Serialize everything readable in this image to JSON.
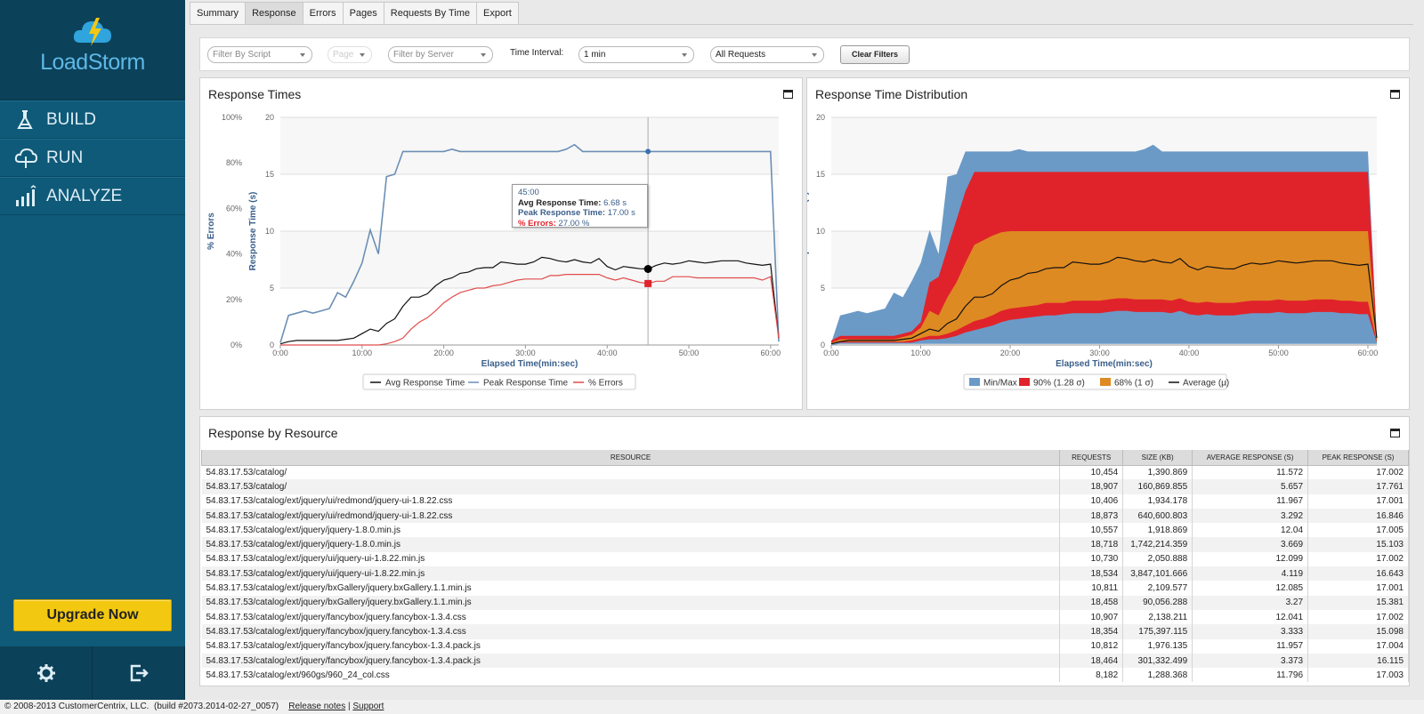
{
  "app": {
    "logo_text": "LoadStorm"
  },
  "sidebar": {
    "nav": [
      {
        "label": "BUILD",
        "icon": "flask-icon"
      },
      {
        "label": "RUN",
        "icon": "cloud-run-icon"
      },
      {
        "label": "ANALYZE",
        "icon": "bar-chart-icon"
      }
    ],
    "upgrade_label": "Upgrade Now",
    "bottom_icons": [
      "gear-icon",
      "logout-icon"
    ]
  },
  "tabs": [
    "Summary",
    "Response",
    "Errors",
    "Pages",
    "Requests By Time",
    "Export"
  ],
  "active_tab": "Response",
  "filters": {
    "script_placeholder": "Filter By Script",
    "page_placeholder": "Page",
    "server_placeholder": "Filter by Server",
    "time_interval_label": "Time Interval:",
    "time_interval_value": "1 min",
    "requests_value": "All Requests",
    "clear_label": "Clear Filters"
  },
  "response_times": {
    "title": "Response Times",
    "legend": [
      "Avg Response Time",
      "Peak Response Time",
      "% Errors"
    ],
    "tooltip": {
      "time": "45:00",
      "avg_label": "Avg Response Time:",
      "avg_value": "6.68 s",
      "peak_label": "Peak Response Time:",
      "peak_value": "17.00 s",
      "err_label": "% Errors:",
      "err_value": "27.00 %"
    }
  },
  "distribution": {
    "title": "Response Time Distribution",
    "legend": [
      "Min/Max",
      "90% (1.28 σ)",
      "68% (1 σ)",
      "Average (μ)"
    ]
  },
  "chart_data": [
    {
      "type": "line",
      "title": "Response Times",
      "xlabel": "Elapsed Time(min:sec)",
      "ylabel": "Response Time (s)",
      "y2label": "% Errors",
      "x_ticks": [
        "0:00",
        "10:00",
        "20:00",
        "30:00",
        "40:00",
        "50:00",
        "60:00"
      ],
      "y_ticks": [
        0,
        5,
        10,
        15,
        20
      ],
      "y2_ticks": [
        "0%",
        "20%",
        "40%",
        "60%",
        "80%",
        "100%"
      ],
      "ylim": [
        0,
        20
      ],
      "y2lim": [
        0,
        100
      ],
      "x": [
        0,
        1,
        2,
        3,
        4,
        5,
        6,
        7,
        8,
        9,
        10,
        11,
        12,
        13,
        14,
        15,
        16,
        17,
        18,
        19,
        20,
        21,
        22,
        23,
        24,
        25,
        26,
        27,
        28,
        29,
        30,
        31,
        32,
        33,
        34,
        35,
        36,
        37,
        38,
        39,
        40,
        41,
        42,
        43,
        44,
        45,
        46,
        47,
        48,
        49,
        50,
        51,
        52,
        53,
        54,
        55,
        56,
        57,
        58,
        59,
        60,
        61
      ],
      "series": [
        {
          "name": "Peak Response Time",
          "color": "#6c8fb5",
          "axis": "left",
          "values": [
            0.2,
            2.6,
            2.8,
            3.0,
            2.8,
            3.0,
            3.2,
            4.6,
            4.2,
            5.6,
            7.2,
            10.1,
            8.0,
            14.8,
            15.0,
            17.0,
            17.0,
            17.0,
            17.0,
            17.0,
            17.0,
            17.2,
            17.0,
            17.0,
            17.0,
            17.0,
            17.0,
            17.0,
            17.0,
            17.0,
            17.0,
            17.0,
            17.0,
            17.0,
            17.0,
            17.2,
            17.6,
            17.0,
            17.0,
            17.0,
            17.0,
            17.0,
            17.0,
            17.0,
            17.0,
            17.0,
            17.0,
            17.0,
            17.0,
            17.0,
            17.0,
            17.0,
            17.0,
            17.0,
            17.0,
            17.0,
            17.0,
            17.0,
            17.0,
            17.0,
            17.0,
            0.3
          ]
        },
        {
          "name": "Avg Response Time",
          "color": "#111111",
          "axis": "left",
          "values": [
            0.1,
            0.3,
            0.4,
            0.4,
            0.4,
            0.4,
            0.4,
            0.4,
            0.5,
            0.6,
            1.0,
            1.4,
            1.2,
            1.9,
            2.3,
            3.4,
            4.2,
            4.2,
            4.5,
            5.2,
            5.7,
            5.9,
            6.3,
            6.4,
            6.7,
            6.8,
            6.8,
            7.3,
            7.2,
            7.1,
            7.1,
            7.3,
            7.7,
            7.6,
            7.4,
            7.3,
            7.5,
            7.3,
            7.2,
            7.6,
            6.9,
            6.6,
            6.9,
            6.8,
            6.7,
            6.68,
            7.0,
            7.2,
            7.1,
            7.2,
            7.4,
            7.3,
            7.2,
            7.3,
            7.4,
            7.4,
            7.4,
            7.2,
            7.1,
            7.0,
            7.1,
            0.6
          ]
        },
        {
          "name": "% Errors",
          "color": "#e24c4c",
          "axis": "right",
          "values": [
            0,
            0,
            0,
            0,
            0,
            0,
            0,
            0,
            0,
            0,
            0,
            0,
            0,
            0.5,
            1.5,
            3,
            7,
            10,
            12,
            15,
            18.5,
            21,
            23,
            24,
            25,
            25,
            26,
            26.5,
            27.5,
            28.5,
            29,
            29,
            29,
            30.5,
            30.5,
            31,
            31,
            31,
            31,
            31,
            29.5,
            28.5,
            29.5,
            28.5,
            27.5,
            27,
            28,
            28,
            30,
            30,
            30,
            29.5,
            29.5,
            29.5,
            29.5,
            29.5,
            29.5,
            29.5,
            29.5,
            28.5,
            30,
            3
          ]
        }
      ]
    },
    {
      "type": "area",
      "title": "Response Time Distribution",
      "xlabel": "Elapsed Time(min:sec)",
      "ylabel": "Response Time (s)",
      "x_ticks": [
        "0:00",
        "10:00",
        "20:00",
        "30:00",
        "40:00",
        "50:00",
        "60:00"
      ],
      "y_ticks": [
        0,
        5,
        10,
        15,
        20
      ],
      "ylim": [
        0,
        20
      ],
      "x": [
        0,
        1,
        2,
        3,
        4,
        5,
        6,
        7,
        8,
        9,
        10,
        11,
        12,
        13,
        14,
        15,
        16,
        17,
        18,
        19,
        20,
        21,
        22,
        23,
        24,
        25,
        26,
        27,
        28,
        29,
        30,
        31,
        32,
        33,
        34,
        35,
        36,
        37,
        38,
        39,
        40,
        41,
        42,
        43,
        44,
        45,
        46,
        47,
        48,
        49,
        50,
        51,
        52,
        53,
        54,
        55,
        56,
        57,
        58,
        59,
        60,
        61
      ],
      "series": [
        {
          "name": "Min/Max",
          "color": "#6b9ac7",
          "low": [
            0,
            0.1,
            0.1,
            0.1,
            0.1,
            0.1,
            0.1,
            0.1,
            0.1,
            0.1,
            0.1,
            0.1,
            0.1,
            0.1,
            0.1,
            0.1,
            0.1,
            0.1,
            0.1,
            0.1,
            0.1,
            0.1,
            0.1,
            0.1,
            0.1,
            0.1,
            0.1,
            0.1,
            0.1,
            0.1,
            0.1,
            0.1,
            0.1,
            0.1,
            0.1,
            0.1,
            0.1,
            0.1,
            0.1,
            0.1,
            0.1,
            0.1,
            0.1,
            0.1,
            0.1,
            0.1,
            0.1,
            0.1,
            0.1,
            0.1,
            0.1,
            0.1,
            0.1,
            0.1,
            0.1,
            0.1,
            0.1,
            0.1,
            0.1,
            0.1,
            0.1,
            0.1
          ],
          "high": [
            0.2,
            2.6,
            2.8,
            3.0,
            2.8,
            3.0,
            3.2,
            4.6,
            4.2,
            5.6,
            7.2,
            10.1,
            8.0,
            14.8,
            15.0,
            17.0,
            17.0,
            17.0,
            17.0,
            17.0,
            17.0,
            17.2,
            17.0,
            17.0,
            17.0,
            17.0,
            17.0,
            17.0,
            17.0,
            17.0,
            17.0,
            17.0,
            17.0,
            17.0,
            17.0,
            17.2,
            17.6,
            17.0,
            17.0,
            17.0,
            17.0,
            17.0,
            17.0,
            17.0,
            17.0,
            17.0,
            17.0,
            17.0,
            17.0,
            17.0,
            17.0,
            17.0,
            17.0,
            17.0,
            17.0,
            17.0,
            17.0,
            17.0,
            17.0,
            17.0,
            17.0,
            0.3
          ]
        },
        {
          "name": "90% (1.28 σ)",
          "color": "#e0232b",
          "low": [
            0.1,
            0.2,
            0.2,
            0.2,
            0.2,
            0.2,
            0.2,
            0.2,
            0.2,
            0.2,
            0.4,
            0.5,
            0.5,
            0.6,
            0.8,
            1.1,
            1.3,
            1.5,
            1.7,
            2.0,
            2.2,
            2.3,
            2.4,
            2.5,
            2.6,
            2.6,
            2.7,
            2.8,
            2.8,
            2.8,
            2.8,
            2.9,
            3.0,
            3.0,
            2.9,
            2.9,
            2.9,
            2.9,
            2.8,
            3.0,
            2.7,
            2.6,
            2.7,
            2.6,
            2.6,
            2.6,
            2.7,
            2.8,
            2.8,
            2.8,
            2.9,
            2.8,
            2.8,
            2.8,
            2.9,
            2.9,
            2.9,
            2.8,
            2.8,
            2.7,
            2.7,
            0.2
          ],
          "high": [
            0.4,
            0.8,
            0.8,
            0.8,
            0.8,
            0.8,
            0.8,
            0.8,
            1.0,
            1.2,
            2.0,
            5.5,
            6.0,
            8.5,
            11.0,
            13.5,
            15.2,
            15.2,
            15.2,
            15.2,
            15.2,
            15.2,
            15.2,
            15.2,
            15.2,
            15.2,
            15.2,
            15.2,
            15.2,
            15.2,
            15.2,
            15.2,
            15.2,
            15.2,
            15.2,
            15.2,
            15.2,
            15.2,
            15.2,
            15.2,
            15.2,
            15.2,
            15.2,
            15.2,
            15.2,
            15.2,
            15.2,
            15.2,
            15.2,
            15.2,
            15.2,
            15.2,
            15.2,
            15.2,
            15.2,
            15.2,
            15.2,
            15.2,
            15.2,
            15.2,
            15.2,
            0.8
          ]
        },
        {
          "name": "68% (1 σ)",
          "color": "#de8a22",
          "low": [
            0.1,
            0.3,
            0.3,
            0.3,
            0.3,
            0.3,
            0.3,
            0.3,
            0.3,
            0.4,
            0.6,
            0.8,
            0.8,
            1.0,
            1.3,
            1.7,
            2.1,
            2.3,
            2.6,
            3.0,
            3.2,
            3.3,
            3.4,
            3.5,
            3.7,
            3.7,
            3.7,
            3.9,
            3.9,
            3.9,
            3.9,
            4.0,
            4.1,
            4.1,
            4.0,
            4.0,
            4.0,
            4.0,
            3.9,
            4.1,
            3.8,
            3.7,
            3.8,
            3.7,
            3.7,
            3.7,
            3.8,
            3.9,
            3.9,
            3.9,
            4.0,
            3.9,
            3.9,
            3.9,
            4.0,
            4.0,
            4.0,
            3.9,
            3.9,
            3.8,
            3.8,
            0.3
          ],
          "high": [
            0.2,
            0.5,
            0.5,
            0.5,
            0.5,
            0.5,
            0.5,
            0.5,
            0.7,
            0.9,
            1.5,
            3.0,
            2.6,
            4.2,
            5.5,
            7.2,
            8.8,
            9.2,
            9.6,
            9.9,
            10.0,
            10.0,
            10.0,
            10.0,
            10.0,
            10.0,
            10.0,
            10.0,
            10.0,
            10.0,
            10.0,
            10.0,
            10.0,
            10.0,
            10.0,
            10.0,
            10.0,
            10.0,
            10.0,
            10.0,
            10.0,
            10.0,
            10.0,
            10.0,
            10.0,
            10.0,
            10.0,
            10.0,
            10.0,
            10.0,
            10.0,
            10.0,
            10.0,
            10.0,
            10.0,
            10.0,
            10.0,
            10.0,
            10.0,
            10.0,
            10.0,
            0.5
          ]
        },
        {
          "name": "Average (μ)",
          "color": "#111111",
          "type": "line",
          "values": [
            0.1,
            0.3,
            0.4,
            0.4,
            0.4,
            0.4,
            0.4,
            0.4,
            0.5,
            0.6,
            1.0,
            1.4,
            1.2,
            1.9,
            2.3,
            3.4,
            4.2,
            4.2,
            4.5,
            5.2,
            5.7,
            5.9,
            6.3,
            6.4,
            6.7,
            6.8,
            6.8,
            7.3,
            7.2,
            7.1,
            7.1,
            7.3,
            7.7,
            7.6,
            7.4,
            7.3,
            7.5,
            7.3,
            7.2,
            7.6,
            6.9,
            6.6,
            6.9,
            6.8,
            6.7,
            6.68,
            7.0,
            7.2,
            7.1,
            7.2,
            7.4,
            7.3,
            7.2,
            7.3,
            7.4,
            7.4,
            7.4,
            7.2,
            7.1,
            7.0,
            7.1,
            0.6
          ]
        }
      ]
    }
  ],
  "resources": {
    "title": "Response by Resource",
    "columns": [
      "RESOURCE",
      "REQUESTS",
      "SIZE (KB)",
      "AVERAGE RESPONSE (S)",
      "PEAK RESPONSE (S)"
    ],
    "rows": [
      [
        "54.83.17.53/catalog/",
        "10,454",
        "1,390.869",
        "11.572",
        "17.002"
      ],
      [
        "54.83.17.53/catalog/",
        "18,907",
        "160,869.855",
        "5.657",
        "17.761"
      ],
      [
        "54.83.17.53/catalog/ext/jquery/ui/redmond/jquery-ui-1.8.22.css",
        "10,406",
        "1,934.178",
        "11.967",
        "17.001"
      ],
      [
        "54.83.17.53/catalog/ext/jquery/ui/redmond/jquery-ui-1.8.22.css",
        "18,873",
        "640,600.803",
        "3.292",
        "16.846"
      ],
      [
        "54.83.17.53/catalog/ext/jquery/jquery-1.8.0.min.js",
        "10,557",
        "1,918.869",
        "12.04",
        "17.005"
      ],
      [
        "54.83.17.53/catalog/ext/jquery/jquery-1.8.0.min.js",
        "18,718",
        "1,742,214.359",
        "3.669",
        "15.103"
      ],
      [
        "54.83.17.53/catalog/ext/jquery/ui/jquery-ui-1.8.22.min.js",
        "10,730",
        "2,050.888",
        "12.099",
        "17.002"
      ],
      [
        "54.83.17.53/catalog/ext/jquery/ui/jquery-ui-1.8.22.min.js",
        "18,534",
        "3,847,101.666",
        "4.119",
        "16.643"
      ],
      [
        "54.83.17.53/catalog/ext/jquery/bxGallery/jquery.bxGallery.1.1.min.js",
        "10,811",
        "2,109.577",
        "12.085",
        "17.001"
      ],
      [
        "54.83.17.53/catalog/ext/jquery/bxGallery/jquery.bxGallery.1.1.min.js",
        "18,458",
        "90,056.288",
        "3.27",
        "15.381"
      ],
      [
        "54.83.17.53/catalog/ext/jquery/fancybox/jquery.fancybox-1.3.4.css",
        "10,907",
        "2,138.211",
        "12.041",
        "17.002"
      ],
      [
        "54.83.17.53/catalog/ext/jquery/fancybox/jquery.fancybox-1.3.4.css",
        "18,354",
        "175,397.115",
        "3.333",
        "15.098"
      ],
      [
        "54.83.17.53/catalog/ext/jquery/fancybox/jquery.fancybox-1.3.4.pack.js",
        "10,812",
        "1,976.135",
        "11.957",
        "17.004"
      ],
      [
        "54.83.17.53/catalog/ext/jquery/fancybox/jquery.fancybox-1.3.4.pack.js",
        "18,464",
        "301,332.499",
        "3.373",
        "16.115"
      ],
      [
        "54.83.17.53/catalog/ext/960gs/960_24_col.css",
        "8,182",
        "1,288.368",
        "11.796",
        "17.003"
      ]
    ]
  },
  "footer": {
    "copyright": "© 2008-2013 CustomerCentrix, LLC.",
    "build": "(build #2073.2014-02-27_0057)",
    "release_notes": "Release notes",
    "separator": "|",
    "support": "Support"
  }
}
